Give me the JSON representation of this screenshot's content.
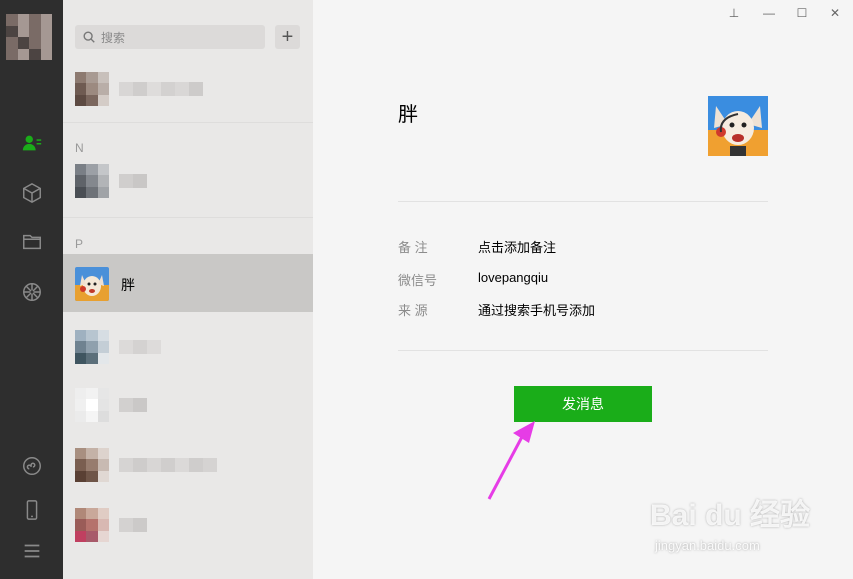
{
  "search": {
    "placeholder": "搜索"
  },
  "add_label": "+",
  "sections": {
    "n": "N",
    "p": "P"
  },
  "selected_contact": {
    "name": "胖"
  },
  "detail": {
    "title": "胖",
    "remark_label": "备  注",
    "remark_value": "点击添加备注",
    "wechat_id_label": "微信号",
    "wechat_id_value": "lovepangqiu",
    "source_label": "来  源",
    "source_value": "通过搜索手机号添加",
    "send_button": "发消息"
  },
  "window_controls": {
    "pin": "⊥",
    "minimize": "—",
    "maximize": "☐",
    "close": "✕"
  },
  "watermark": {
    "main": "Bai du 经验",
    "sub": "jingyan.baidu.com"
  },
  "colors": {
    "accent": "#1aad19",
    "arrow": "#e63ce6",
    "nav_bg": "#2e2e2e"
  }
}
